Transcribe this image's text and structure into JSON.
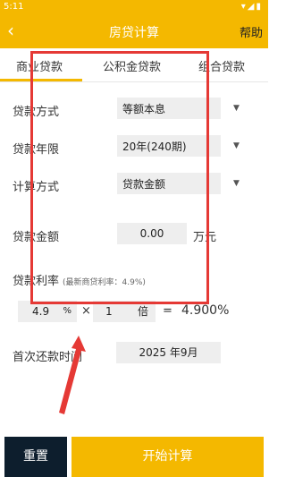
{
  "status_bar": {
    "time": "5:11",
    "icons": "▾◢▮"
  },
  "app_bar": {
    "back_icon": "‹",
    "title": "房贷计算",
    "help": "帮助"
  },
  "tabs": [
    {
      "label": "商业贷款",
      "selected": true
    },
    {
      "label": "公积金贷款",
      "selected": false
    },
    {
      "label": "组合贷款",
      "selected": false
    }
  ],
  "form": {
    "repayment_method": {
      "label": "贷款方式",
      "value": "等额本息"
    },
    "loan_term": {
      "label": "贷款年限",
      "value": "20年(240期)"
    },
    "calc_method": {
      "label": "计算方式",
      "value": "贷款金额"
    },
    "loan_amount": {
      "label": "贷款金额",
      "value": "0.00",
      "unit": "万元"
    },
    "interest_rate": {
      "label": "贷款利率",
      "hint": "(最新商贷利率：4.9%)",
      "base_rate": "4.9",
      "percent_sign": "%",
      "multiply_sign": "×",
      "multiplier": "1",
      "multiplier_unit": "倍",
      "equals_sign": "=",
      "result": "4.900%"
    },
    "first_payment": {
      "label": "首次还款时间",
      "value": "2025 年9月"
    }
  },
  "buttons": {
    "reset": "重置",
    "start": "开始计算"
  },
  "colors": {
    "accent": "#f4b800",
    "dark_button": "#0d1e2d",
    "annotation": "#e53935"
  }
}
